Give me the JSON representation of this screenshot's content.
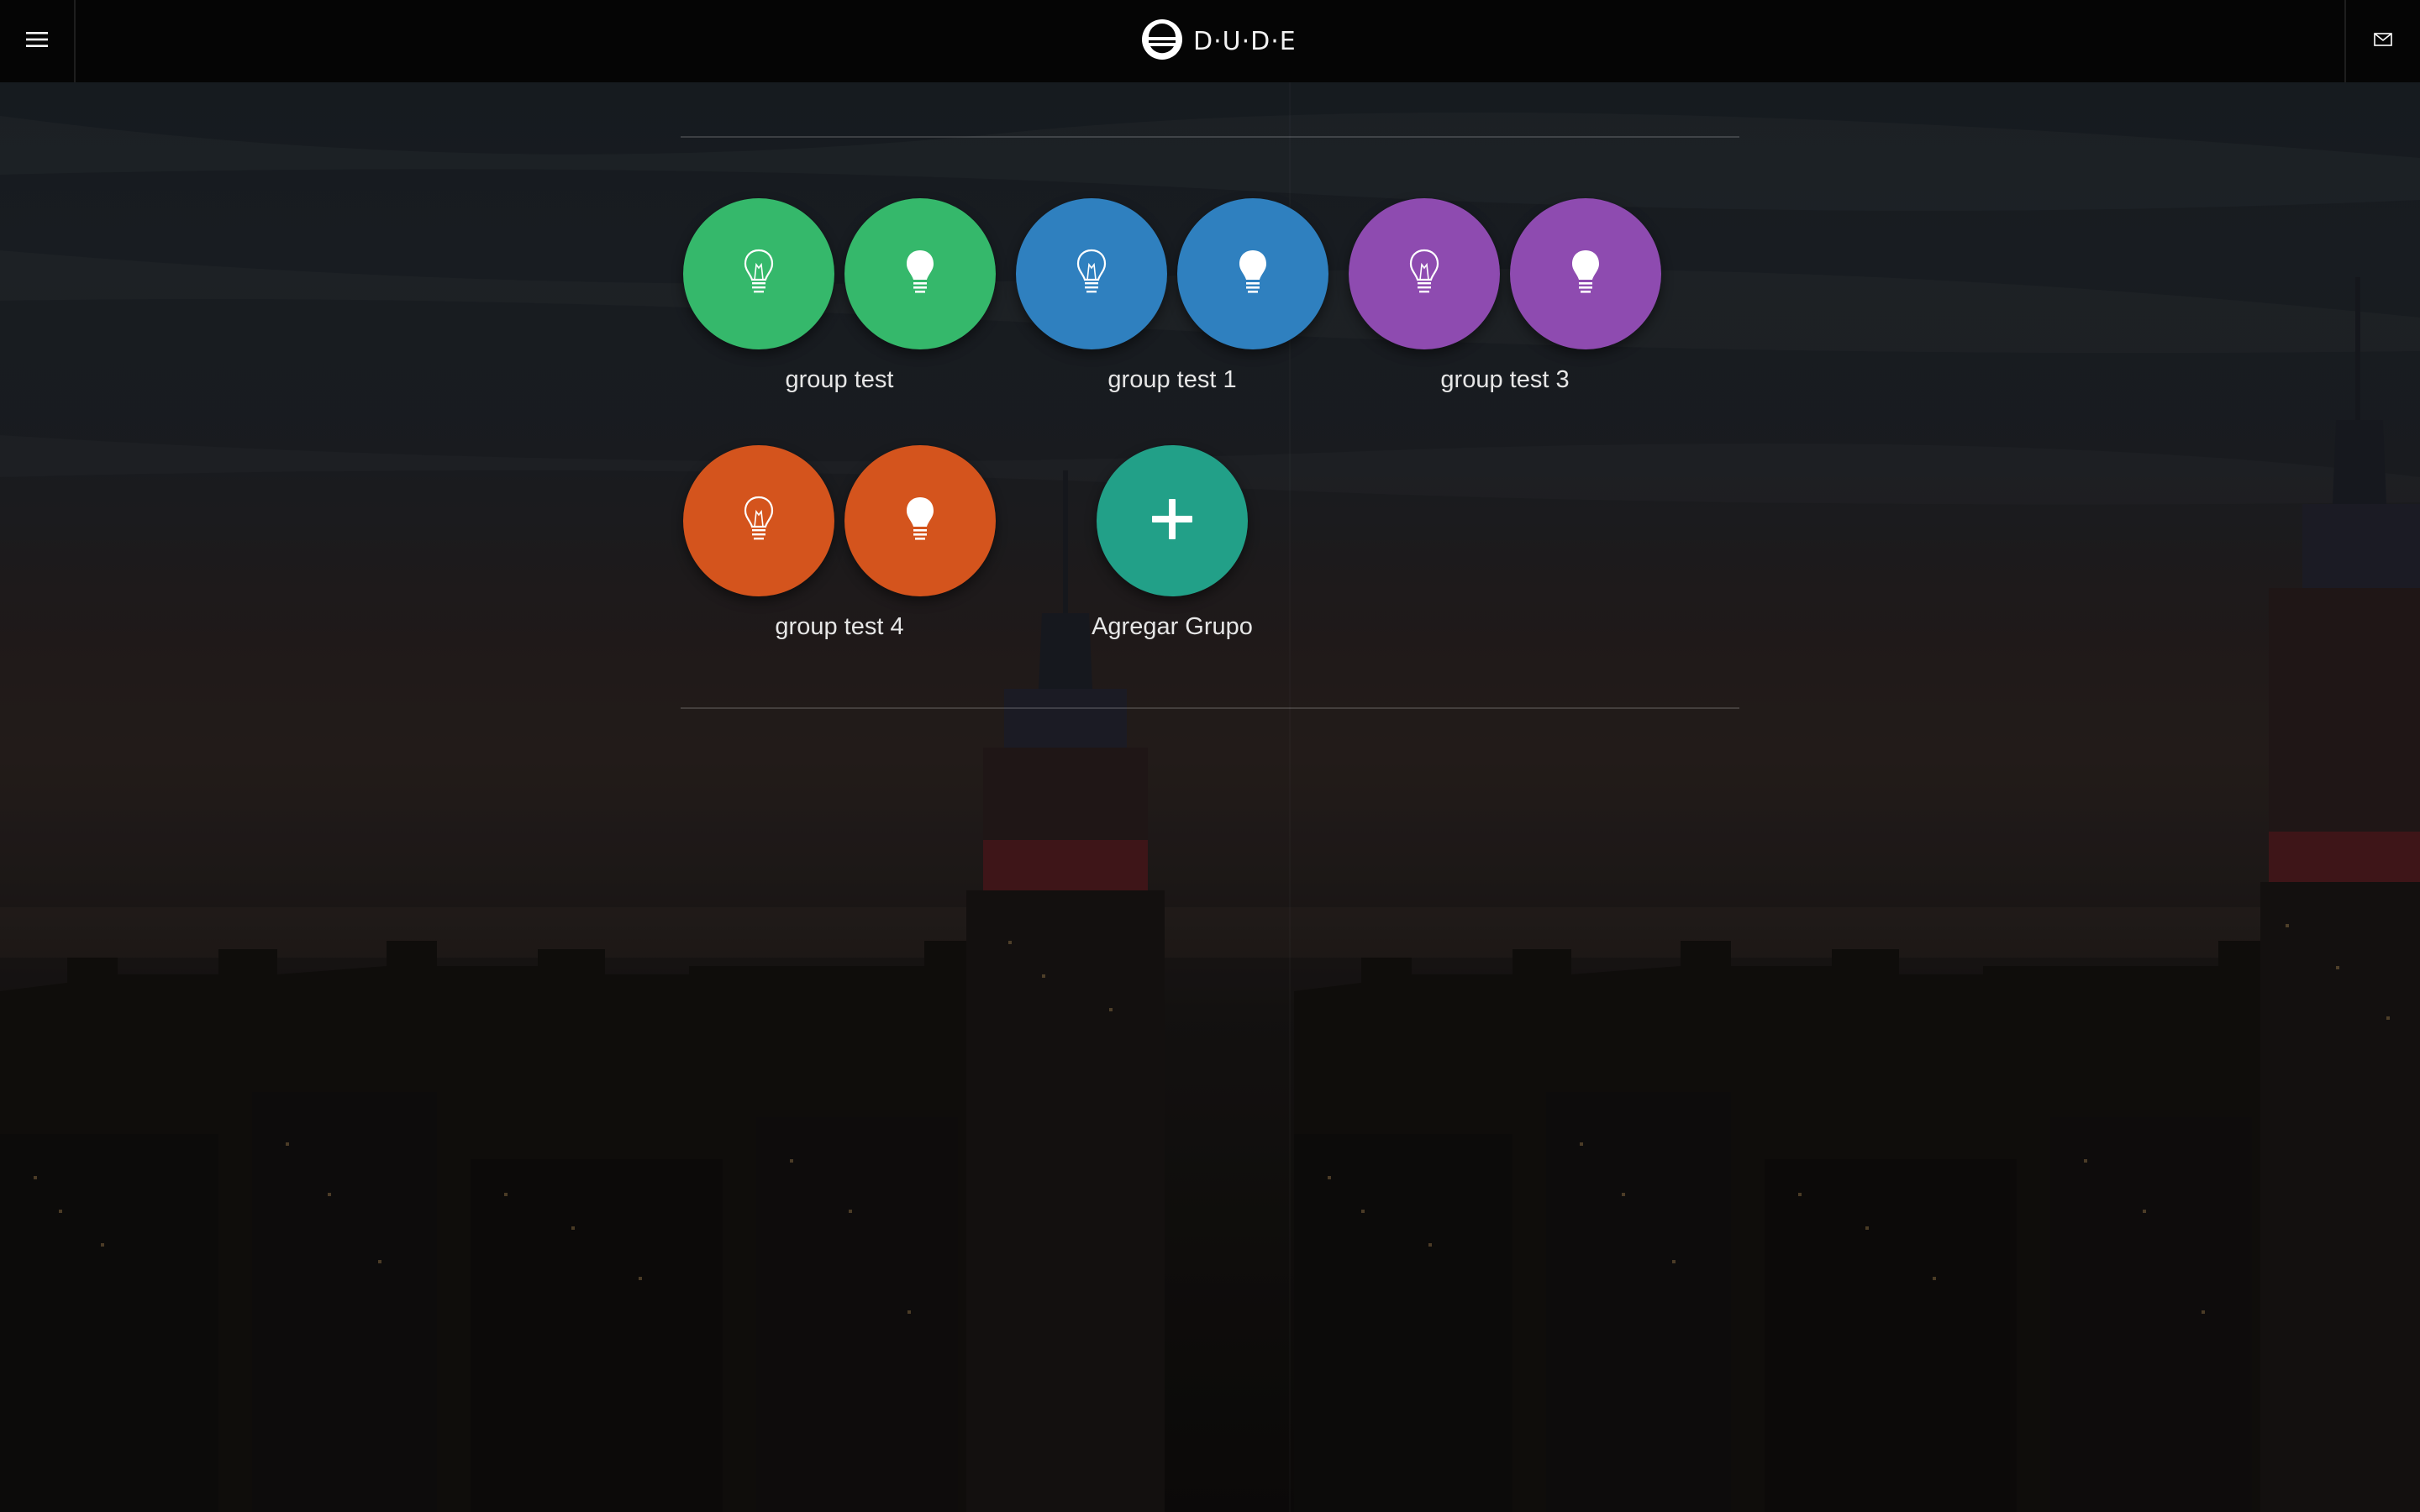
{
  "app": {
    "brand": "D·U·D·E"
  },
  "topbar": {
    "menu_icon": "hamburger-menu-icon",
    "logo_icon": "dude-logo-icon",
    "mail_icon": "mail-icon"
  },
  "groups": [
    {
      "name": "group test",
      "color": "#35b86b",
      "buttons": [
        {
          "icon": "lightbulb-outline-icon",
          "state": "off"
        },
        {
          "icon": "lightbulb-filled-icon",
          "state": "on"
        }
      ]
    },
    {
      "name": "group test 1",
      "color": "#2f80bf",
      "buttons": [
        {
          "icon": "lightbulb-outline-icon",
          "state": "off"
        },
        {
          "icon": "lightbulb-filled-icon",
          "state": "on"
        }
      ]
    },
    {
      "name": "group test 3",
      "color": "#8e4bb0",
      "buttons": [
        {
          "icon": "lightbulb-outline-icon",
          "state": "off"
        },
        {
          "icon": "lightbulb-filled-icon",
          "state": "on"
        }
      ]
    },
    {
      "name": "group test 4",
      "color": "#d4541d",
      "buttons": [
        {
          "icon": "lightbulb-outline-icon",
          "state": "off"
        },
        {
          "icon": "lightbulb-filled-icon",
          "state": "on"
        }
      ]
    }
  ],
  "add_group": {
    "label": "Agregar Grupo",
    "icon": "plus-icon",
    "color": "#22a088"
  }
}
